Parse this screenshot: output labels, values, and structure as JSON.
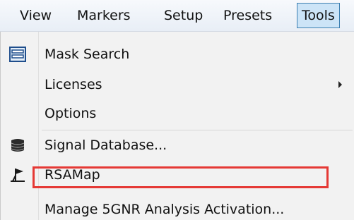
{
  "menubar": {
    "items": [
      {
        "label": "View"
      },
      {
        "label": "Markers"
      },
      {
        "label": "Setup"
      },
      {
        "label": "Presets"
      },
      {
        "label": "Tools",
        "active": true
      }
    ]
  },
  "dropdown": {
    "items": [
      {
        "label": "Mask Search",
        "icon": "mask-search-icon"
      },
      {
        "label": "Licenses",
        "submenu": true
      },
      {
        "label": "Options"
      },
      {
        "label": "Signal Database...",
        "icon": "database-icon"
      },
      {
        "label": "RSAMap",
        "icon": "rsamap-icon"
      },
      {
        "label": "Manage 5GNR Analysis Activation...",
        "highlighted": true
      }
    ]
  },
  "colors": {
    "active_menu_bg": "#cce4f7",
    "active_menu_border": "#3c7fb1",
    "highlight_border": "#e53935",
    "menu_bg": "#f2f2f2"
  }
}
